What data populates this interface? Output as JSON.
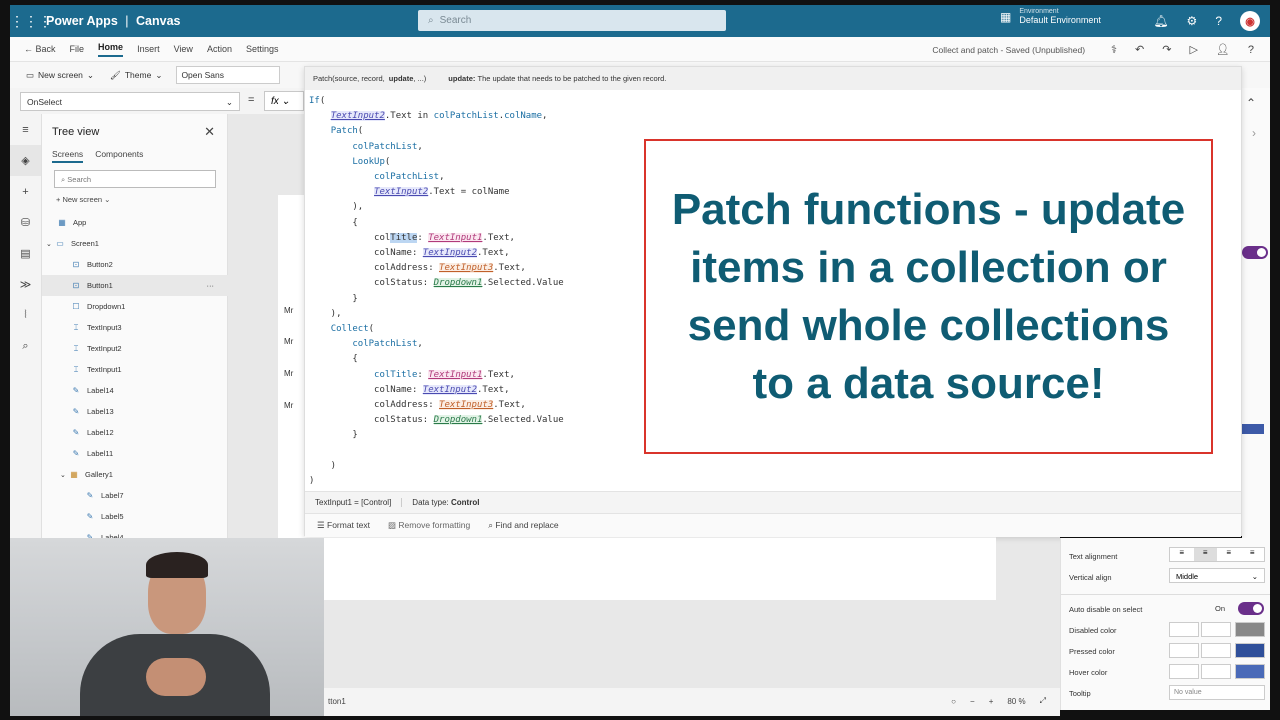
{
  "topbar": {
    "app_name": "Power Apps",
    "separator": "|",
    "app_type": "Canvas",
    "search_placeholder": "Search",
    "env_label": "Environment",
    "env_name": "Default Environment"
  },
  "menubar": {
    "back": "Back",
    "items": [
      "File",
      "Home",
      "Insert",
      "View",
      "Action",
      "Settings"
    ],
    "active": "Home",
    "save_status": "Collect and patch - Saved (Unpublished)"
  },
  "ribbon": {
    "new_screen": "New screen",
    "theme": "Theme",
    "font": "Open Sans"
  },
  "formula": {
    "property": "OnSelect",
    "equals": "=",
    "fx": "fx"
  },
  "hint": {
    "signature_pre": "Patch(source, record, ",
    "signature_bold": "update",
    "signature_post": ", ...)",
    "param_name": "update:",
    "param_desc": "The update that needs to be patched to the given record."
  },
  "tree": {
    "title": "Tree view",
    "tab_screens": "Screens",
    "tab_components": "Components",
    "search_placeholder": "Search",
    "new_screen": "New screen",
    "items": [
      {
        "label": "App"
      },
      {
        "label": "Screen1"
      },
      {
        "label": "Button2"
      },
      {
        "label": "Button1"
      },
      {
        "label": "Dropdown1"
      },
      {
        "label": "TextInput3"
      },
      {
        "label": "TextInput2"
      },
      {
        "label": "TextInput1"
      },
      {
        "label": "Label14"
      },
      {
        "label": "Label13"
      },
      {
        "label": "Label12"
      },
      {
        "label": "Label11"
      },
      {
        "label": "Gallery1"
      },
      {
        "label": "Label7"
      },
      {
        "label": "Label5"
      },
      {
        "label": "Label4"
      }
    ]
  },
  "canvas": {
    "mr_labels": [
      "Mr",
      "Mr",
      "Mr",
      "Mr"
    ]
  },
  "status": {
    "control": "TextInput1",
    "eq": "=",
    "kind": "[Control]",
    "datatype_label": "Data type:",
    "datatype_value": "Control"
  },
  "format_bar": {
    "format_text": "Format text",
    "remove_formatting": "Remove formatting",
    "find_replace": "Find and replace"
  },
  "callout": {
    "text": "Patch functions - update items in a collection or send whole collections to a data source!"
  },
  "right_panel": {
    "text_alignment": "Text alignment",
    "vertical_align": "Vertical align",
    "vertical_align_value": "Middle",
    "auto_disable": "Auto disable on select",
    "auto_disable_value": "On",
    "disabled_color": "Disabled color",
    "pressed_color": "Pressed color",
    "hover_color": "Hover color",
    "tooltip": "Tooltip",
    "tooltip_value": "No value"
  },
  "bottom": {
    "control_name": "tton1",
    "zoom": "80 %"
  },
  "colors": {
    "brand": "#1c6a8e",
    "callout_text": "#0f5c73",
    "callout_border": "#d9342b"
  }
}
